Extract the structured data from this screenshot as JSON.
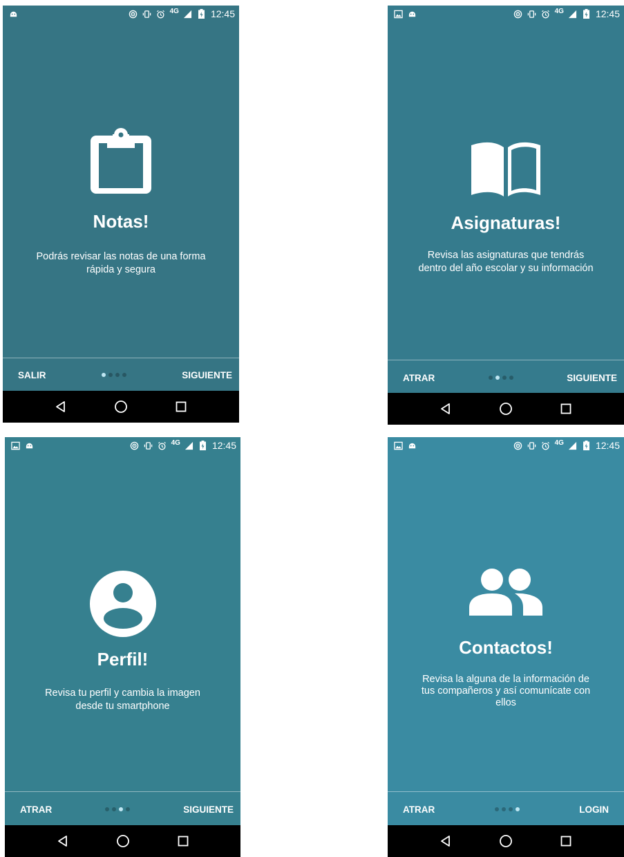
{
  "status_bar": {
    "time": "12:45",
    "network": "4G"
  },
  "screens": [
    {
      "bg": "#367584",
      "icon": "clipboard-icon",
      "title": "Notas!",
      "description": "Podrás revisar las notas de una forma\nrápida y segura",
      "left_button": "SALIR",
      "right_button": "SIGUIENTE",
      "page_index": 1,
      "page_count": 4
    },
    {
      "bg": "#357b8d",
      "icon": "book-icon",
      "title": "Asignaturas!",
      "description": "Revisa las asignaturas que tendrás\ndentro del año escolar y su información",
      "left_button": "ATRAR",
      "right_button": "SIGUIENTE",
      "page_index": 2,
      "page_count": 4
    },
    {
      "bg": "#36808f",
      "icon": "account-circle-icon",
      "title": "Perfil!",
      "description": "Revisa tu perfil y cambia la imagen\ndesde tu smartphone",
      "left_button": "ATRAR",
      "right_button": "SIGUIENTE",
      "page_index": 3,
      "page_count": 4
    },
    {
      "bg": "#3a8ba2",
      "icon": "people-icon",
      "title": "Contactos!",
      "description": "Revisa la alguna de la información de\ntus compañeros y así comunícate con\nellos",
      "left_button": "ATRAR",
      "right_button": "LOGIN",
      "page_index": 4,
      "page_count": 4
    }
  ]
}
